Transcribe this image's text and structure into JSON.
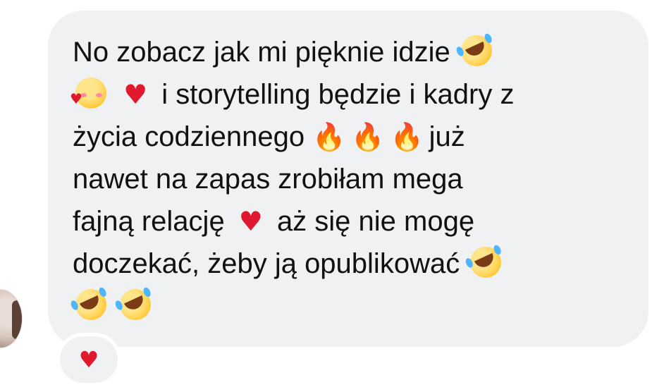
{
  "message": {
    "lines": [
      {
        "text_1": "No zobacz jak mi pięknie idzie"
      },
      {
        "text_1": "i storytelling będzie i kadry z"
      },
      {
        "text_1": "życia codziennego",
        "text_2": "już"
      },
      {
        "text_1": "nawet na zapas zrobiłam mega"
      },
      {
        "text_1": "fajną relację",
        "text_2": "aż się nie mogę"
      },
      {
        "text_1": "doczekać, żeby ją opublikować"
      },
      {
        "text_1": ""
      }
    ],
    "emoji": {
      "heart": "♥",
      "fire": "🔥"
    }
  },
  "reaction": {
    "emoji": "♥",
    "name": "heart-reaction"
  },
  "colors": {
    "bubble_background": "#f0f1f3",
    "text": "#111111",
    "heart": "#e0192e",
    "fire": "#f5581c",
    "laugh_face": "#ffc93a"
  }
}
